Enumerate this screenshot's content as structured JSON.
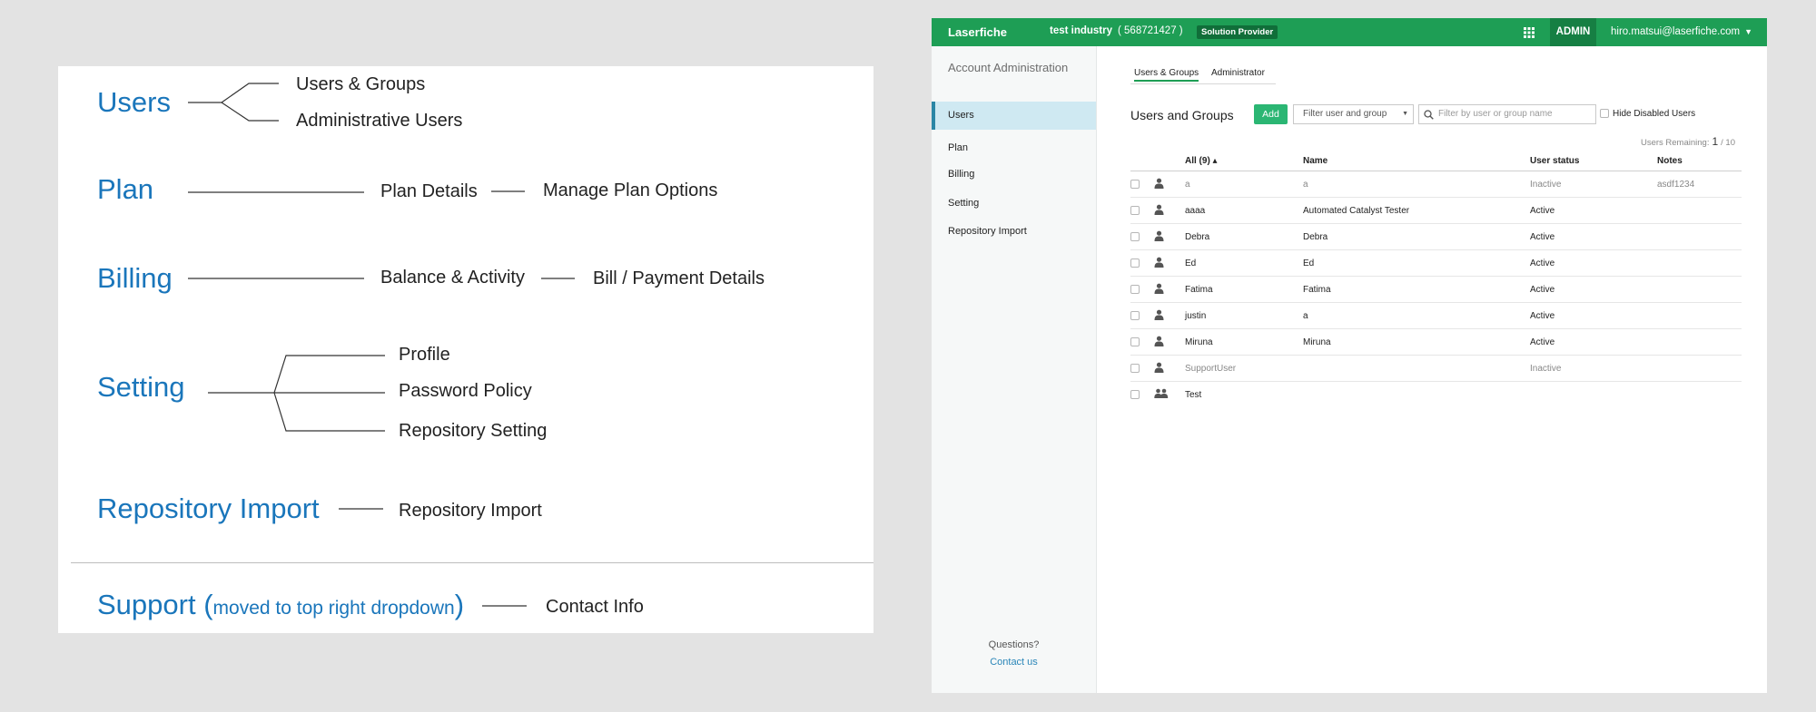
{
  "sitemap": {
    "users": {
      "title": "Users",
      "children": [
        "Users & Groups",
        "Administrative Users"
      ]
    },
    "plan": {
      "title": "Plan",
      "children": [
        "Plan Details",
        "Manage Plan Options"
      ]
    },
    "billing": {
      "title": "Billing",
      "children": [
        "Balance & Activity",
        "Bill / Payment Details"
      ]
    },
    "setting": {
      "title": "Setting",
      "children": [
        "Profile",
        "Password Policy",
        "Repository Setting"
      ]
    },
    "repository_import": {
      "title": "Repository Import",
      "children": [
        "Repository Import"
      ]
    },
    "support": {
      "title_prefix": "Support (",
      "title_note": "moved to top right dropdown",
      "title_suffix": ")",
      "children": [
        "Contact Info"
      ]
    }
  },
  "app": {
    "topbar": {
      "brand": "Laserfiche",
      "tenant": "test industry",
      "account_id": "( 568721427 )",
      "badge": "Solution Provider",
      "admin_label": "ADMIN",
      "user_email": "hiro.matsui@laserfiche.com",
      "icons": [
        "apps-grid-icon",
        "caret-down-icon"
      ]
    },
    "sidebar": {
      "title": "Account Administration",
      "items": [
        "Users",
        "Plan",
        "Billing",
        "Setting",
        "Repository Import"
      ],
      "active": "Users",
      "questions": "Questions?",
      "contact": "Contact us"
    },
    "main": {
      "tabs": [
        "Users & Groups",
        "Administrator"
      ],
      "active_tab": "Users & Groups",
      "section_title": "Users and Groups",
      "add_button": "Add",
      "filter_select": "Filter user and group",
      "search_placeholder": "Filter by user or group name",
      "hide_disabled": "Hide Disabled Users",
      "remaining_label": "Users Remaining:",
      "remaining_count": "1",
      "remaining_total": "/ 10",
      "columns": [
        "All (9) ▴",
        "Name",
        "User status",
        "Notes"
      ],
      "rows": [
        {
          "icon": "user-icon",
          "user": "a",
          "name": "a",
          "status": "Inactive",
          "notes": "asdf1234",
          "muted": true
        },
        {
          "icon": "user-icon",
          "user": "aaaa",
          "name": "Automated Catalyst Tester",
          "status": "Active",
          "notes": "",
          "muted": false
        },
        {
          "icon": "user-icon",
          "user": "Debra",
          "name": "Debra",
          "status": "Active",
          "notes": "",
          "muted": false
        },
        {
          "icon": "user-icon",
          "user": "Ed",
          "name": "Ed",
          "status": "Active",
          "notes": "",
          "muted": false
        },
        {
          "icon": "user-icon",
          "user": "Fatima",
          "name": "Fatima",
          "status": "Active",
          "notes": "",
          "muted": false
        },
        {
          "icon": "user-icon",
          "user": "justin",
          "name": "a",
          "status": "Active",
          "notes": "",
          "muted": false
        },
        {
          "icon": "user-icon",
          "user": "Miruna",
          "name": "Miruna",
          "status": "Active",
          "notes": "",
          "muted": false
        },
        {
          "icon": "user-icon",
          "user": "SupportUser",
          "name": "",
          "status": "Inactive",
          "notes": "",
          "muted": true
        },
        {
          "icon": "group-icon",
          "user": "Test",
          "name": "",
          "status": "",
          "notes": "",
          "muted": false
        }
      ]
    },
    "colors": {
      "topbar": "#1e9e55",
      "accent_blue": "#1a76bb",
      "add_button": "#2bb673",
      "active_nav": "#cfe9f2"
    }
  }
}
